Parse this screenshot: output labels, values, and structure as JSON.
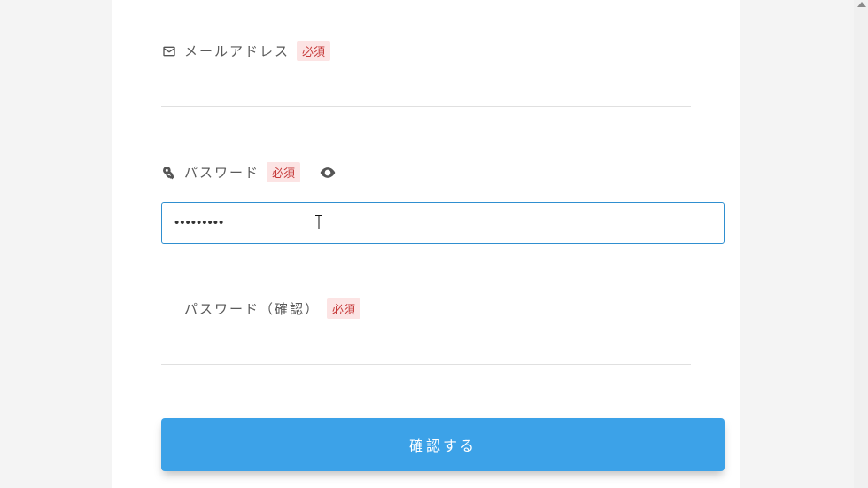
{
  "colors": {
    "accent": "#3ca2e8",
    "required_bg": "#fce4e4",
    "required_fg": "#c63a3a",
    "focus_border": "#2f8fd0"
  },
  "fields": {
    "email": {
      "label": "メールアドレス",
      "required_text": "必須",
      "value": ""
    },
    "password": {
      "label": "パスワード",
      "required_text": "必須",
      "value": "•••••••••"
    },
    "password_confirm": {
      "label": "パスワード（確認）",
      "required_text": "必須",
      "value": ""
    }
  },
  "submit_label": "確認する"
}
